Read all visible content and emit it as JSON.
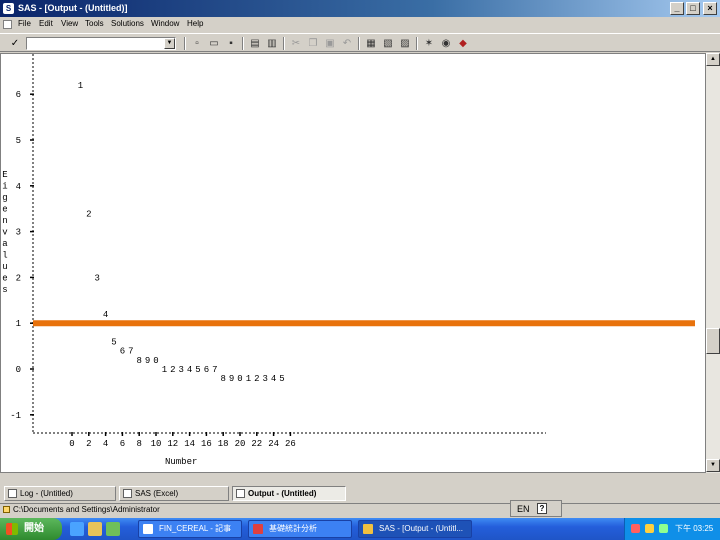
{
  "window": {
    "title": "SAS - [Output - (Untitled)]",
    "buttons": {
      "minimize": "_",
      "maximize": "□",
      "close": "×"
    }
  },
  "menu": [
    "File",
    "Edit",
    "View",
    "Tools",
    "Solutions",
    "Window",
    "Help"
  ],
  "toolbar": {
    "command_value": "",
    "check_glyph": "✓",
    "icons": [
      "new-icon",
      "open-icon",
      "save-icon",
      "print-icon",
      "print-preview-icon",
      "cut-icon",
      "copy-icon",
      "paste-icon",
      "undo-icon",
      "libraries-icon",
      "explorer-icon",
      "results-icon",
      "submit-icon",
      "break-icon",
      "help-icon"
    ]
  },
  "chart_data": {
    "type": "scatter",
    "title": "",
    "xlabel": "Number",
    "ylabel": "Eigenvalues",
    "xlim": [
      -1,
      28
    ],
    "ylim": [
      -1.2,
      6.6
    ],
    "x_ticks": [
      0,
      2,
      4,
      6,
      8,
      10,
      12,
      14,
      16,
      18,
      20,
      22,
      24,
      26
    ],
    "y_ticks": [
      -1,
      0,
      1,
      2,
      3,
      4,
      5,
      6
    ],
    "points": [
      {
        "x": 1,
        "y": 6.2,
        "label": "1"
      },
      {
        "x": 2,
        "y": 3.4,
        "label": "2"
      },
      {
        "x": 3,
        "y": 2.0,
        "label": "3"
      },
      {
        "x": 4,
        "y": 1.2,
        "label": "4"
      },
      {
        "x": 5,
        "y": 0.6,
        "label": "5"
      },
      {
        "x": 6,
        "y": 0.4,
        "label": "6"
      },
      {
        "x": 7,
        "y": 0.4,
        "label": "7"
      },
      {
        "x": 8,
        "y": 0.2,
        "label": "8"
      },
      {
        "x": 9,
        "y": 0.2,
        "label": "9"
      },
      {
        "x": 10,
        "y": 0.2,
        "label": "0"
      },
      {
        "x": 11,
        "y": 0.0,
        "label": "1"
      },
      {
        "x": 12,
        "y": 0.0,
        "label": "2"
      },
      {
        "x": 13,
        "y": 0.0,
        "label": "3"
      },
      {
        "x": 14,
        "y": 0.0,
        "label": "4"
      },
      {
        "x": 15,
        "y": 0.0,
        "label": "5"
      },
      {
        "x": 16,
        "y": 0.0,
        "label": "6"
      },
      {
        "x": 17,
        "y": 0.0,
        "label": "7"
      },
      {
        "x": 18,
        "y": -0.2,
        "label": "8"
      },
      {
        "x": 19,
        "y": -0.2,
        "label": "9"
      },
      {
        "x": 20,
        "y": -0.2,
        "label": "0"
      },
      {
        "x": 21,
        "y": -0.2,
        "label": "1"
      },
      {
        "x": 22,
        "y": -0.2,
        "label": "2"
      },
      {
        "x": 23,
        "y": -0.2,
        "label": "3"
      },
      {
        "x": 24,
        "y": -0.2,
        "label": "4"
      },
      {
        "x": 25,
        "y": -0.2,
        "label": "5"
      }
    ],
    "reference_line": {
      "y": 1,
      "color": "#e8720c"
    },
    "grid": false
  },
  "window_tabs": [
    "Log - (Untitled)",
    "SAS (Excel)",
    "Output - (Untitled)"
  ],
  "status": {
    "path": "C:\\Documents and Settings\\Administrator"
  },
  "ime": {
    "lang": "EN",
    "help": "?"
  },
  "taskbar": {
    "start": "開始",
    "tasks": [
      "FIN_CEREAL - 記事",
      "基礎統計分析",
      "SAS - [Output - (Untitl..."
    ],
    "clock": "下午 03:25"
  },
  "colors": {
    "reference_line": "#e8720c",
    "titlebar": "#0a246a"
  }
}
